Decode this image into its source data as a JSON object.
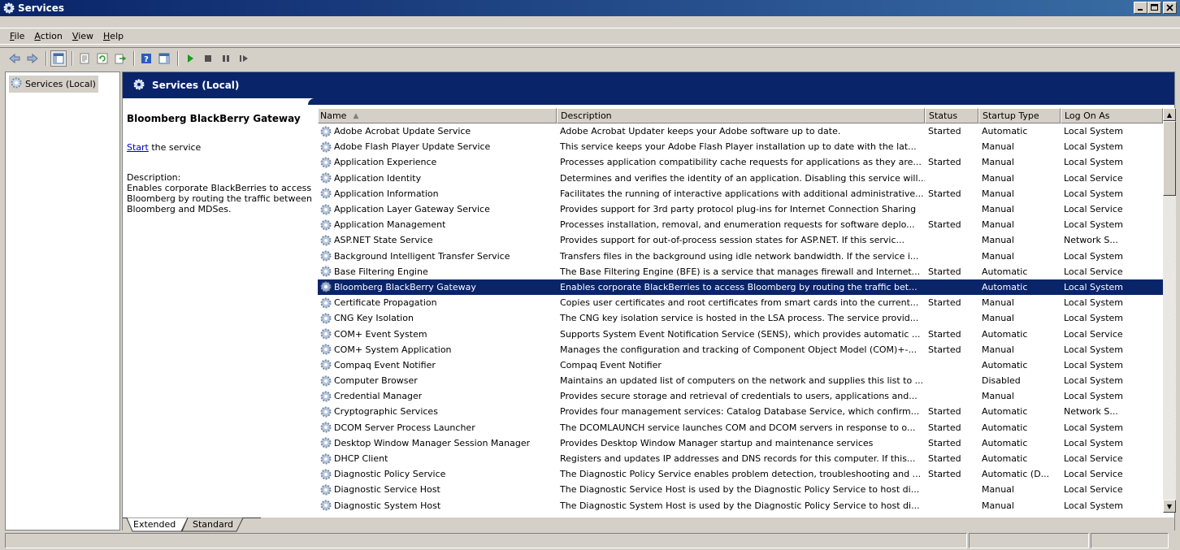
{
  "window": {
    "title": "Services",
    "buttons": [
      "_",
      "□",
      "X"
    ]
  },
  "menu": [
    "File",
    "Action",
    "View",
    "Help"
  ],
  "toolbar": {
    "icons": [
      "back-icon",
      "forward-icon",
      "show-console-tree-icon",
      "properties-icon",
      "refresh-icon",
      "export-list-icon",
      "help-icon",
      "show-hide-action-pane-icon",
      "start-service-icon",
      "stop-service-icon",
      "pause-service-icon",
      "resume-service-icon"
    ]
  },
  "tree": {
    "item": "Services (Local)"
  },
  "header": {
    "title": "Services (Local)"
  },
  "details": {
    "service_name": "Bloomberg BlackBerry Gateway",
    "start_link": "Start",
    "start_suffix": " the service",
    "description_label": "Description:",
    "description_text": "Enables corporate BlackBerries to access Bloomberg by routing the traffic between Bloomberg and MDSes."
  },
  "columns": {
    "name": "Name",
    "description": "Description",
    "status": "Status",
    "startup": "Startup Type",
    "logon": "Log On As"
  },
  "rows": [
    {
      "name": "Adobe Acrobat Update Service",
      "description": "Adobe Acrobat Updater keeps your Adobe software up to date.",
      "status": "Started",
      "startup": "Automatic",
      "logon": "Local System"
    },
    {
      "name": "Adobe Flash Player Update Service",
      "description": "This service keeps your Adobe Flash Player installation up to date with the lat...",
      "status": "",
      "startup": "Manual",
      "logon": "Local System"
    },
    {
      "name": "Application Experience",
      "description": "Processes application compatibility cache requests for applications as they are...",
      "status": "Started",
      "startup": "Manual",
      "logon": "Local System"
    },
    {
      "name": "Application Identity",
      "description": "Determines and verifies the identity of an application. Disabling this service will...",
      "status": "",
      "startup": "Manual",
      "logon": "Local Service"
    },
    {
      "name": "Application Information",
      "description": "Facilitates the running of interactive applications with additional administrative...",
      "status": "Started",
      "startup": "Manual",
      "logon": "Local System"
    },
    {
      "name": "Application Layer Gateway Service",
      "description": "Provides support for 3rd party protocol plug-ins for Internet Connection Sharing",
      "status": "",
      "startup": "Manual",
      "logon": "Local Service"
    },
    {
      "name": "Application Management",
      "description": "Processes installation, removal, and enumeration requests for software deplo...",
      "status": "Started",
      "startup": "Manual",
      "logon": "Local System"
    },
    {
      "name": "ASP.NET State Service",
      "description": "Provides support for out-of-process session states for ASP.NET. If this servic...",
      "status": "",
      "startup": "Manual",
      "logon": "Network S..."
    },
    {
      "name": "Background Intelligent Transfer Service",
      "description": "Transfers files in the background using idle network bandwidth. If the service i...",
      "status": "",
      "startup": "Manual",
      "logon": "Local System"
    },
    {
      "name": "Base Filtering Engine",
      "description": "The Base Filtering Engine (BFE) is a service that manages firewall and Internet...",
      "status": "Started",
      "startup": "Automatic",
      "logon": "Local Service"
    },
    {
      "name": "Bloomberg BlackBerry Gateway",
      "description": "Enables corporate BlackBerries to access Bloomberg by routing the traffic bet...",
      "status": "",
      "startup": "Automatic",
      "logon": "Local System",
      "selected": true
    },
    {
      "name": "Certificate Propagation",
      "description": "Copies user certificates and root certificates from smart cards into the current...",
      "status": "Started",
      "startup": "Manual",
      "logon": "Local System"
    },
    {
      "name": "CNG Key Isolation",
      "description": "The CNG key isolation service is hosted in the LSA process. The service provid...",
      "status": "",
      "startup": "Manual",
      "logon": "Local System"
    },
    {
      "name": "COM+ Event System",
      "description": "Supports System Event Notification Service (SENS), which provides automatic ...",
      "status": "Started",
      "startup": "Automatic",
      "logon": "Local Service"
    },
    {
      "name": "COM+ System Application",
      "description": "Manages the configuration and tracking of Component Object Model (COM)+-...",
      "status": "Started",
      "startup": "Manual",
      "logon": "Local System"
    },
    {
      "name": "Compaq Event Notifier",
      "description": "Compaq Event Notifier",
      "status": "",
      "startup": "Automatic",
      "logon": "Local System"
    },
    {
      "name": "Computer Browser",
      "description": "Maintains an updated list of computers on the network and supplies this list to ...",
      "status": "",
      "startup": "Disabled",
      "logon": "Local System"
    },
    {
      "name": "Credential Manager",
      "description": "Provides secure storage and retrieval of credentials to users, applications and...",
      "status": "",
      "startup": "Manual",
      "logon": "Local System"
    },
    {
      "name": "Cryptographic Services",
      "description": "Provides four management services: Catalog Database Service, which confirm...",
      "status": "Started",
      "startup": "Automatic",
      "logon": "Network S..."
    },
    {
      "name": "DCOM Server Process Launcher",
      "description": "The DCOMLAUNCH service launches COM and DCOM servers in response to o...",
      "status": "Started",
      "startup": "Automatic",
      "logon": "Local System"
    },
    {
      "name": "Desktop Window Manager Session Manager",
      "description": "Provides Desktop Window Manager startup and maintenance services",
      "status": "Started",
      "startup": "Automatic",
      "logon": "Local System"
    },
    {
      "name": "DHCP Client",
      "description": "Registers and updates IP addresses and DNS records for this computer. If this...",
      "status": "Started",
      "startup": "Automatic",
      "logon": "Local Service"
    },
    {
      "name": "Diagnostic Policy Service",
      "description": "The Diagnostic Policy Service enables problem detection, troubleshooting and ...",
      "status": "Started",
      "startup": "Automatic (D...",
      "logon": "Local Service"
    },
    {
      "name": "Diagnostic Service Host",
      "description": "The Diagnostic Service Host is used by the Diagnostic Policy Service to host di...",
      "status": "",
      "startup": "Manual",
      "logon": "Local Service"
    },
    {
      "name": "Diagnostic System Host",
      "description": "The Diagnostic System Host is used by the Diagnostic Policy Service to host di...",
      "status": "",
      "startup": "Manual",
      "logon": "Local System"
    }
  ],
  "tabs": {
    "extended": "Extended",
    "standard": "Standard"
  }
}
